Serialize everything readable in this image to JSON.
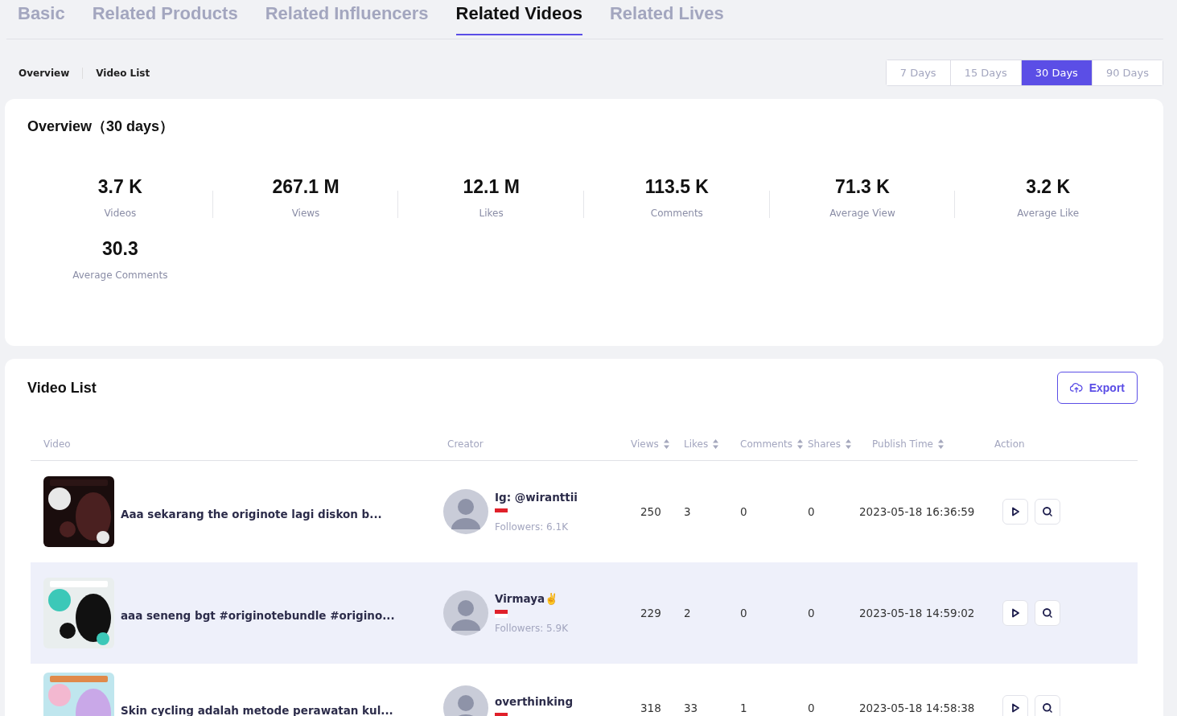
{
  "tabs": [
    {
      "label": "Basic",
      "selected": false
    },
    {
      "label": "Related Products",
      "selected": false
    },
    {
      "label": "Related Influencers",
      "selected": false
    },
    {
      "label": "Related Videos",
      "selected": true
    },
    {
      "label": "Related Lives",
      "selected": false
    }
  ],
  "subnav": [
    {
      "label": "Overview"
    },
    {
      "label": "Video List"
    }
  ],
  "ranges": [
    {
      "label": "7 Days",
      "selected": false
    },
    {
      "label": "15 Days",
      "selected": false
    },
    {
      "label": "30 Days",
      "selected": true
    },
    {
      "label": "90 Days",
      "selected": false
    }
  ],
  "overview": {
    "title": "Overview（30 days）",
    "stats": [
      {
        "value": "3.7 K",
        "label": "Videos"
      },
      {
        "value": "267.1 M",
        "label": "Views"
      },
      {
        "value": "12.1 M",
        "label": "Likes"
      },
      {
        "value": "113.5 K",
        "label": "Comments"
      },
      {
        "value": "71.3 K",
        "label": "Average View"
      },
      {
        "value": "3.2 K",
        "label": "Average Like"
      },
      {
        "value": "30.3",
        "label": "Average Comments"
      }
    ]
  },
  "video_list": {
    "title": "Video List",
    "export_label": "Export",
    "columns": [
      {
        "label": "Video",
        "sortable": false
      },
      {
        "label": "Creator",
        "sortable": false
      },
      {
        "label": "Views",
        "sortable": true
      },
      {
        "label": "Likes",
        "sortable": true
      },
      {
        "label": "Comments",
        "sortable": true
      },
      {
        "label": "Shares",
        "sortable": true
      },
      {
        "label": "Publish Time",
        "sortable": true
      },
      {
        "label": "Action",
        "sortable": false
      }
    ],
    "rows": [
      {
        "title": "Aaa sekarang the originote lagi diskon b...",
        "creator": "Ig: @wiranttii",
        "followers": "Followers: 6.1K",
        "views": "250",
        "likes": "3",
        "comments": "0",
        "shares": "0",
        "time": "2023-05-18 16:36:59",
        "highlighted": false
      },
      {
        "title": "aaa seneng bgt #originotebundle #origino...",
        "creator": "Virmaya✌️",
        "followers": "Followers: 5.9K",
        "views": "229",
        "likes": "2",
        "comments": "0",
        "shares": "0",
        "time": "2023-05-18 14:59:02",
        "highlighted": true
      },
      {
        "title": "Skin cycling adalah metode perawatan kul...",
        "creator": "overthinking",
        "views": "318",
        "likes": "33",
        "comments": "1",
        "shares": "0",
        "time": "2023-05-18 14:58:38",
        "highlighted": false
      }
    ]
  }
}
